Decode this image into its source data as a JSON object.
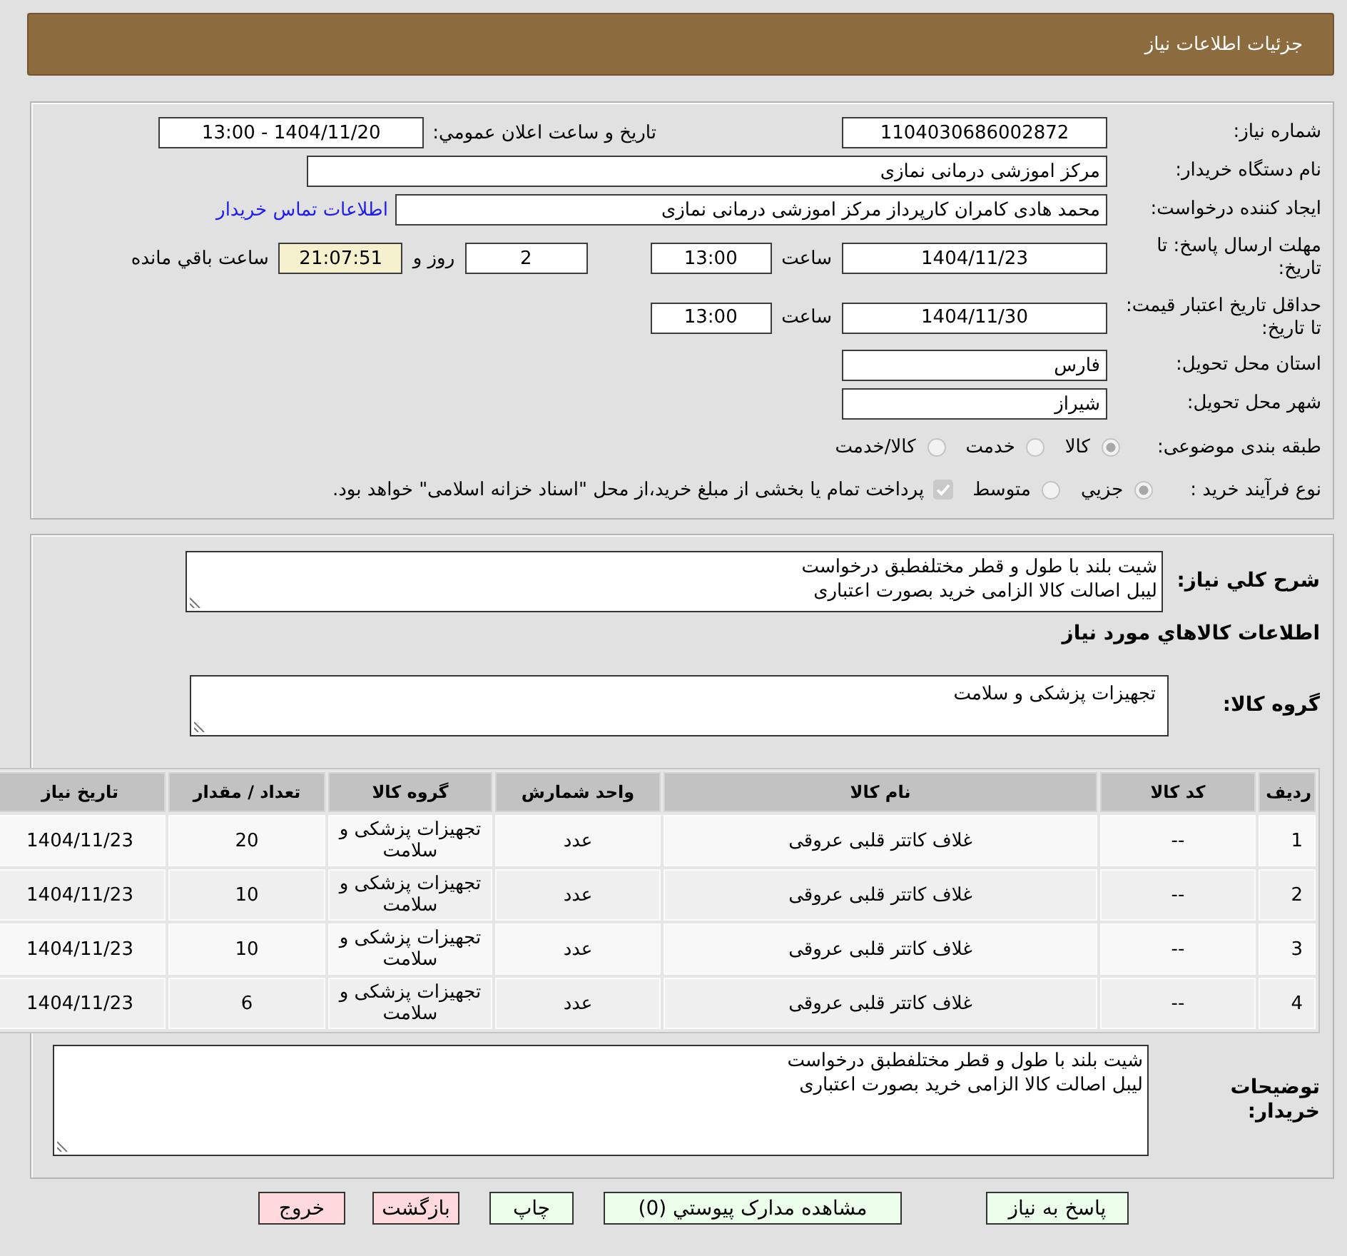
{
  "header": {
    "title": "جزئیات اطلاعات نیاز"
  },
  "details": {
    "need_number": {
      "label": "شماره نیاز:",
      "value": "1104030686002872"
    },
    "announcement": {
      "label": "تاريخ و ساعت اعلان عمومي:",
      "value": "1404/11/20 - 13:00"
    },
    "buyer_organization": {
      "label": "نام دستگاه خریدار:",
      "value": "مرکز اموزشی درمانی نمازی"
    },
    "requester": {
      "label": "ایجاد کننده درخواست:",
      "value": "محمد هادی کامران کارپرداز مرکز اموزشی درمانی نمازی",
      "link": "اطلاعات تماس خریدار"
    },
    "response_deadline": {
      "label": "مهلت ارسال پاسخ: تا تاریخ:",
      "date": "1404/11/23",
      "time_label": "ساعت",
      "time": "13:00",
      "days": "2",
      "days_label": "روز و",
      "remaining": "21:07:51",
      "remaining_label": "ساعت باقي مانده"
    },
    "price_validity": {
      "label": "حداقل تاریخ اعتبار قیمت: تا تاریخ:",
      "date": "1404/11/30",
      "time_label": "ساعت",
      "time": "13:00"
    },
    "delivery_province": {
      "label": "استان محل تحویل:",
      "value": "فارس"
    },
    "delivery_city": {
      "label": "شهر محل تحویل:",
      "value": "شیراز"
    },
    "subject_category": {
      "label": "طبقه بندی موضوعی:",
      "disabled": true,
      "options": [
        {
          "label": "کالا",
          "selected": true
        },
        {
          "label": "خدمت",
          "selected": false
        },
        {
          "label": "کالا/خدمت",
          "selected": false
        }
      ]
    },
    "purchase_process": {
      "label": "نوع فرآیند خرید :",
      "disabled": true,
      "options": [
        {
          "label": "جزيي",
          "selected": true
        },
        {
          "label": "متوسط",
          "selected": false
        }
      ],
      "treasury_option": {
        "label": "پرداخت تمام یا بخشی از مبلغ خرید،از محل \"اسناد خزانه اسلامی\" خواهد بود.",
        "checked": true,
        "disabled": true
      }
    }
  },
  "need_description": {
    "label": "شرح کلي نياز:",
    "value": "شیت بلند با طول و قطر مختلفطبق درخواست\nلیبل اصالت کالا الزامی خرید بصورت اعتباری"
  },
  "goods_section": {
    "title": "اطلاعات کالاهاي مورد نياز",
    "group_label": "گروه کالا:",
    "group_value": "تجهیزات پزشکی و سلامت"
  },
  "table": {
    "columns": [
      "ردیف",
      "کد کالا",
      "نام کالا",
      "واحد شمارش",
      "گروه کالا",
      "تعداد / مقدار",
      "تاریخ نیاز"
    ],
    "rows": [
      [
        "1",
        "--",
        "غلاف کاتتر قلبی عروقی",
        "عدد",
        "تجهیزات پزشکی و سلامت",
        "20",
        "1404/11/23"
      ],
      [
        "2",
        "--",
        "غلاف کاتتر قلبی عروقی",
        "عدد",
        "تجهیزات پزشکی و سلامت",
        "10",
        "1404/11/23"
      ],
      [
        "3",
        "--",
        "غلاف کاتتر قلبی عروقی",
        "عدد",
        "تجهیزات پزشکی و سلامت",
        "10",
        "1404/11/23"
      ],
      [
        "4",
        "--",
        "غلاف کاتتر قلبی عروقی",
        "عدد",
        "تجهیزات پزشکی و سلامت",
        "6",
        "1404/11/23"
      ]
    ]
  },
  "buyer_notes": {
    "label": "توضیحات خریدار:",
    "value": "شیت بلند با طول و قطر مختلفطبق درخواست\nلیبل اصالت کالا الزامی خرید بصورت اعتباری"
  },
  "buttons": [
    {
      "label": "پاسخ به نیاز",
      "kind": "action"
    },
    {
      "label": "مشاهده مدارک پیوستي (0)",
      "kind": "action"
    },
    {
      "label": "چاپ",
      "kind": "action"
    },
    {
      "label": "بازگشت",
      "kind": "exit"
    },
    {
      "label": "خروج",
      "kind": "exit"
    }
  ]
}
